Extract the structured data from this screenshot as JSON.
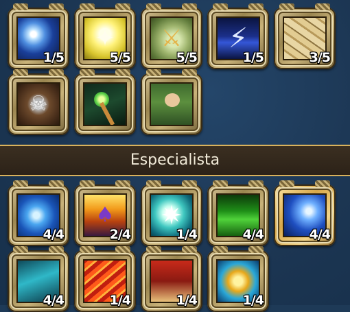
{
  "grid_top": {
    "slots": [
      {
        "name": "energy-orb-skill",
        "icon": "energy-orb-icon",
        "level": "1/5"
      },
      {
        "name": "holy-light-figure-skill",
        "icon": "light-figure-icon",
        "level": "5/5"
      },
      {
        "name": "nature-scythe-skill",
        "icon": "scythe-icon",
        "level": "5/5"
      },
      {
        "name": "lightning-skill",
        "icon": "lightning-icon",
        "level": "1/5"
      },
      {
        "name": "earth-cracks-skill",
        "icon": "cracked-earth-icon",
        "level": "3/5"
      },
      {
        "name": "skull-shield-skill",
        "icon": "skull-shield-icon",
        "level": ""
      },
      {
        "name": "staff-orb-skill",
        "icon": "staff-orb-icon",
        "level": ""
      },
      {
        "name": "green-hood-character-skill",
        "icon": "hooded-character-icon",
        "level": ""
      }
    ]
  },
  "section": {
    "title": "Especialista"
  },
  "grid_bottom": {
    "slots": [
      {
        "name": "water-swirl-skill",
        "icon": "water-swirl-icon",
        "level": "4/4"
      },
      {
        "name": "fire-mage-skill",
        "icon": "fire-mage-icon",
        "level": "2/4"
      },
      {
        "name": "light-burst-skill",
        "icon": "light-burst-icon",
        "level": "1/4"
      },
      {
        "name": "green-forest-skill",
        "icon": "forest-icon",
        "level": "4/4"
      },
      {
        "name": "blue-vortex-skill",
        "icon": "vortex-icon",
        "level": "4/4"
      },
      {
        "name": "cyan-wave-skill",
        "icon": "wave-icon",
        "level": "4/4"
      },
      {
        "name": "flaming-arrows-skill",
        "icon": "flaming-arrows-icon",
        "level": "1/4"
      },
      {
        "name": "warrior-cape-skill",
        "icon": "warrior-cape-icon",
        "level": "1/4"
      },
      {
        "name": "golden-gem-skill",
        "icon": "golden-gem-icon",
        "level": "1/4"
      }
    ]
  },
  "colors": {
    "background": "#1e3a57",
    "frame_gold": "#c9b37a",
    "section_border": "#d9b25c",
    "text": "#ffffff"
  }
}
